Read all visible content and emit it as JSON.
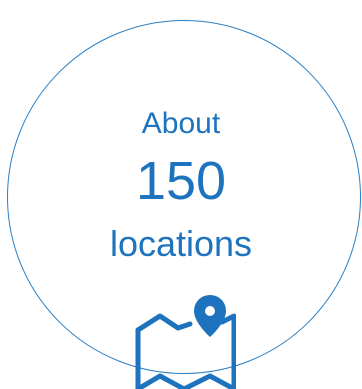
{
  "badge": {
    "prefix": "About",
    "count": "150",
    "unit": "locations"
  },
  "icons": {
    "map": "map-with-location-pin-icon"
  },
  "colors": {
    "accent": "#1e73be",
    "ring": "#2a7fc4",
    "background": "#ffffff"
  }
}
